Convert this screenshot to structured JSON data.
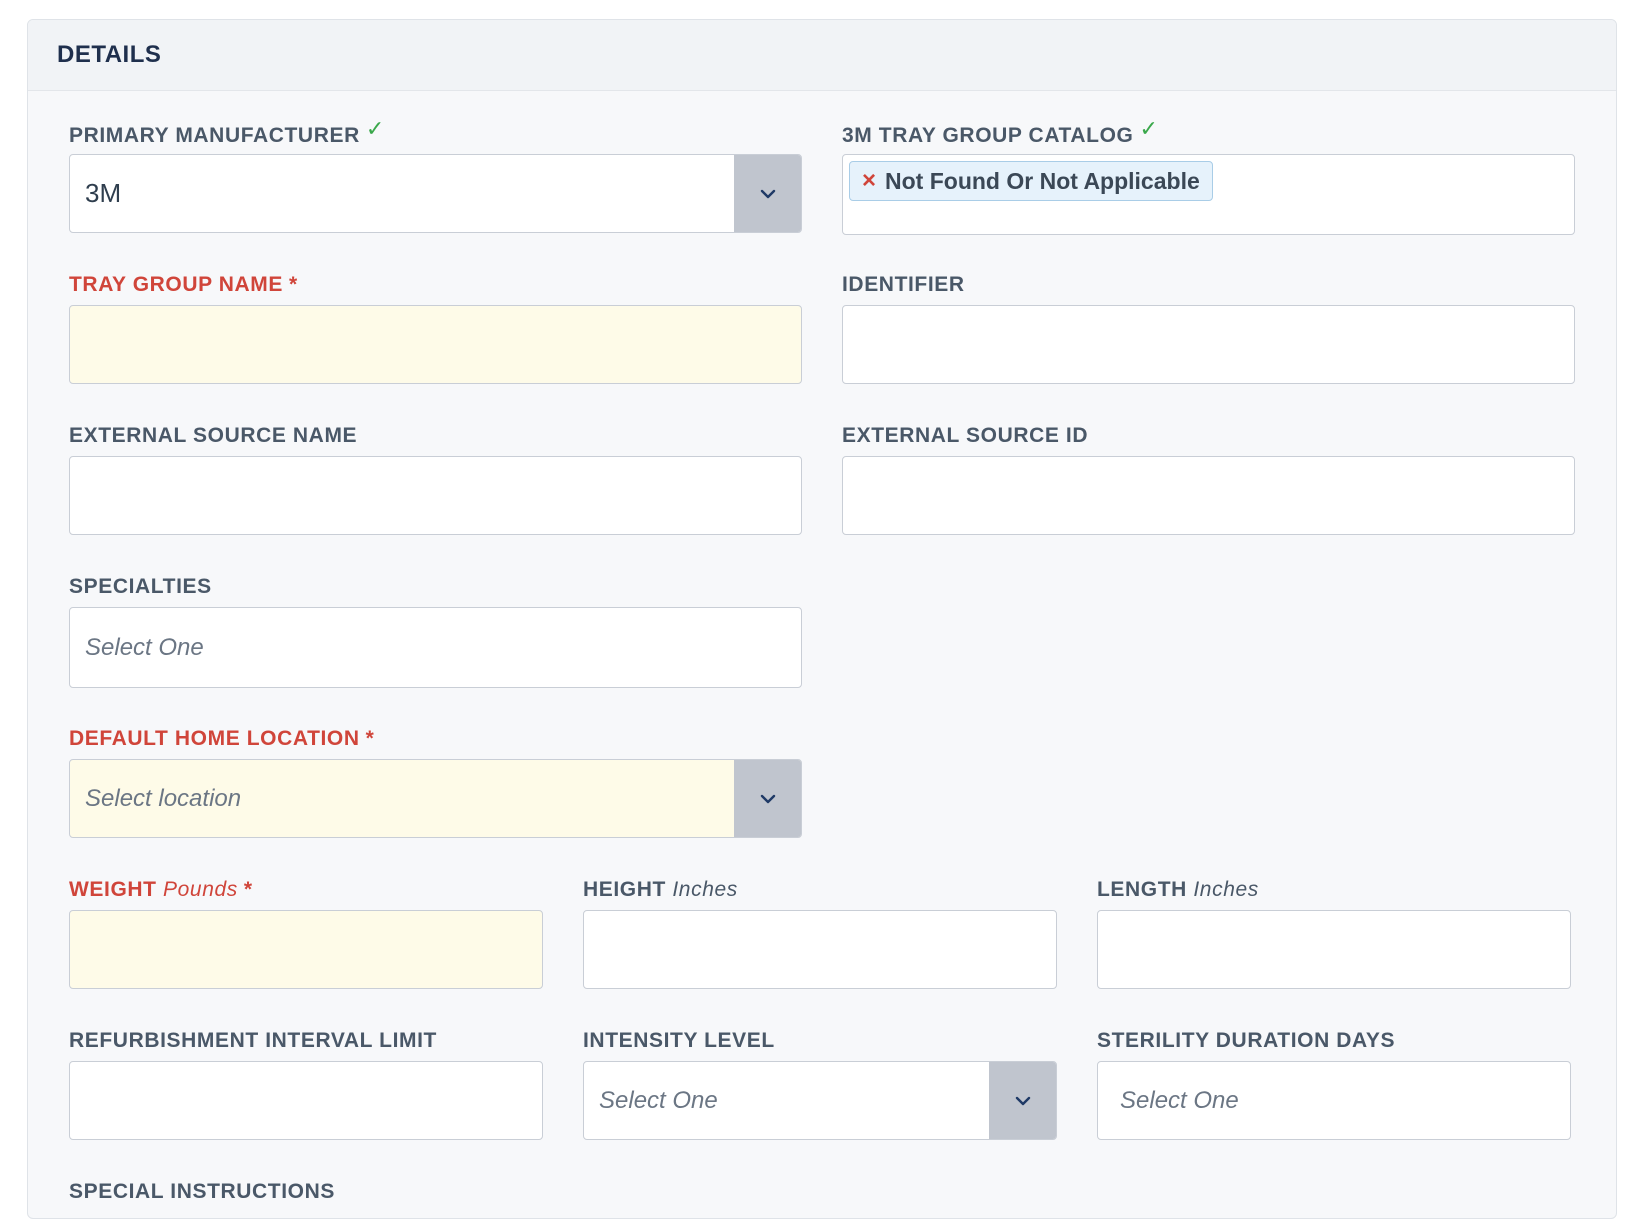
{
  "panel": {
    "title": "DETAILS"
  },
  "fields": {
    "primary_manufacturer": {
      "label": "PRIMARY MANUFACTURER",
      "check": "✓",
      "value": "3M"
    },
    "tray_group_catalog": {
      "label": "3M TRAY GROUP CATALOG",
      "check": "✓",
      "tag": "Not Found Or Not Applicable",
      "tag_remove": "×"
    },
    "tray_group_name": {
      "label": "TRAY GROUP NAME",
      "required_mark": "*",
      "value": ""
    },
    "identifier": {
      "label": "IDENTIFIER",
      "value": ""
    },
    "external_source_name": {
      "label": "EXTERNAL SOURCE NAME",
      "value": ""
    },
    "external_source_id": {
      "label": "EXTERNAL SOURCE ID",
      "value": ""
    },
    "specialties": {
      "label": "SPECIALTIES",
      "placeholder": "Select One"
    },
    "default_home_location": {
      "label": "DEFAULT HOME LOCATION",
      "required_mark": "*",
      "placeholder": "Select location"
    },
    "weight": {
      "label": "WEIGHT",
      "unit": "Pounds",
      "required_mark": "*",
      "value": ""
    },
    "height": {
      "label": "HEIGHT",
      "unit": "Inches",
      "value": ""
    },
    "length": {
      "label": "LENGTH",
      "unit": "Inches",
      "value": ""
    },
    "refurbishment_interval_limit": {
      "label": "REFURBISHMENT INTERVAL LIMIT",
      "value": ""
    },
    "intensity_level": {
      "label": "INTENSITY LEVEL",
      "placeholder": "Select One"
    },
    "sterility_duration_days": {
      "label": "STERILITY DURATION DAYS",
      "placeholder": "Select One"
    },
    "special_instructions": {
      "label": "SPECIAL INSTRUCTIONS"
    }
  },
  "icons": {
    "dropdown": "chevron-down-icon",
    "check": "check-icon",
    "remove": "close-icon"
  },
  "colors": {
    "required": "#d0453a",
    "valid": "#3aa84b",
    "required_fill": "#fefbe8",
    "toggle": "#c0c5ce"
  }
}
